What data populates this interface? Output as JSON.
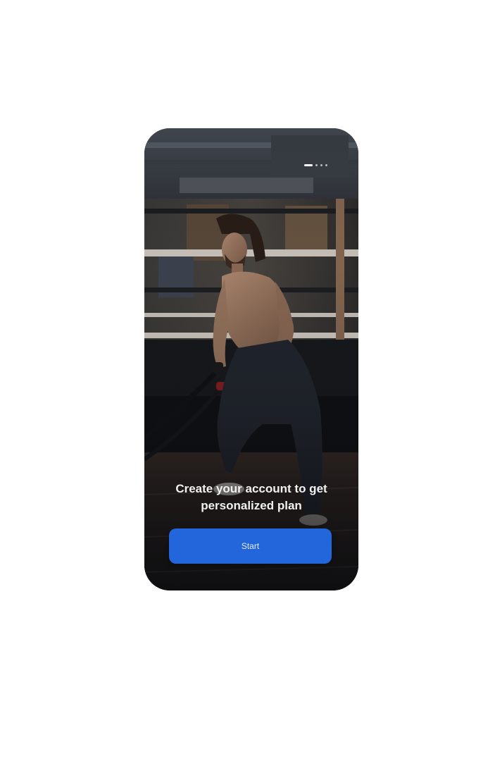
{
  "onboarding": {
    "headline": "Create your account to get personalized plan",
    "start_label": "Start"
  },
  "pager": {
    "total": 4,
    "active_index": 0
  },
  "colors": {
    "accent": "#2366dc",
    "page_background": "#ffffff"
  },
  "background_image": {
    "icon": "gym-photo"
  }
}
